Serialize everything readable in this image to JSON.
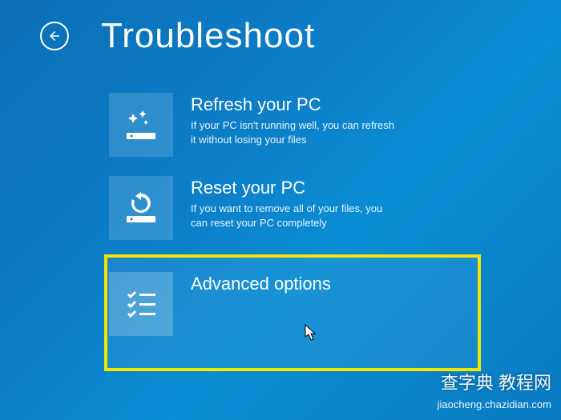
{
  "header": {
    "title": "Troubleshoot"
  },
  "options": [
    {
      "icon": "sparkle-drive-icon",
      "title": "Refresh your PC",
      "desc": "If your PC isn't running well, you can refresh it without losing your files"
    },
    {
      "icon": "reset-drive-icon",
      "title": "Reset your PC",
      "desc": "If you want to remove all of your files, you can reset your PC completely"
    },
    {
      "icon": "list-icon",
      "title": "Advanced options",
      "desc": ""
    }
  ],
  "watermark": {
    "text": "查字典 教程网",
    "url": "jiaocheng.chazidian.com"
  }
}
